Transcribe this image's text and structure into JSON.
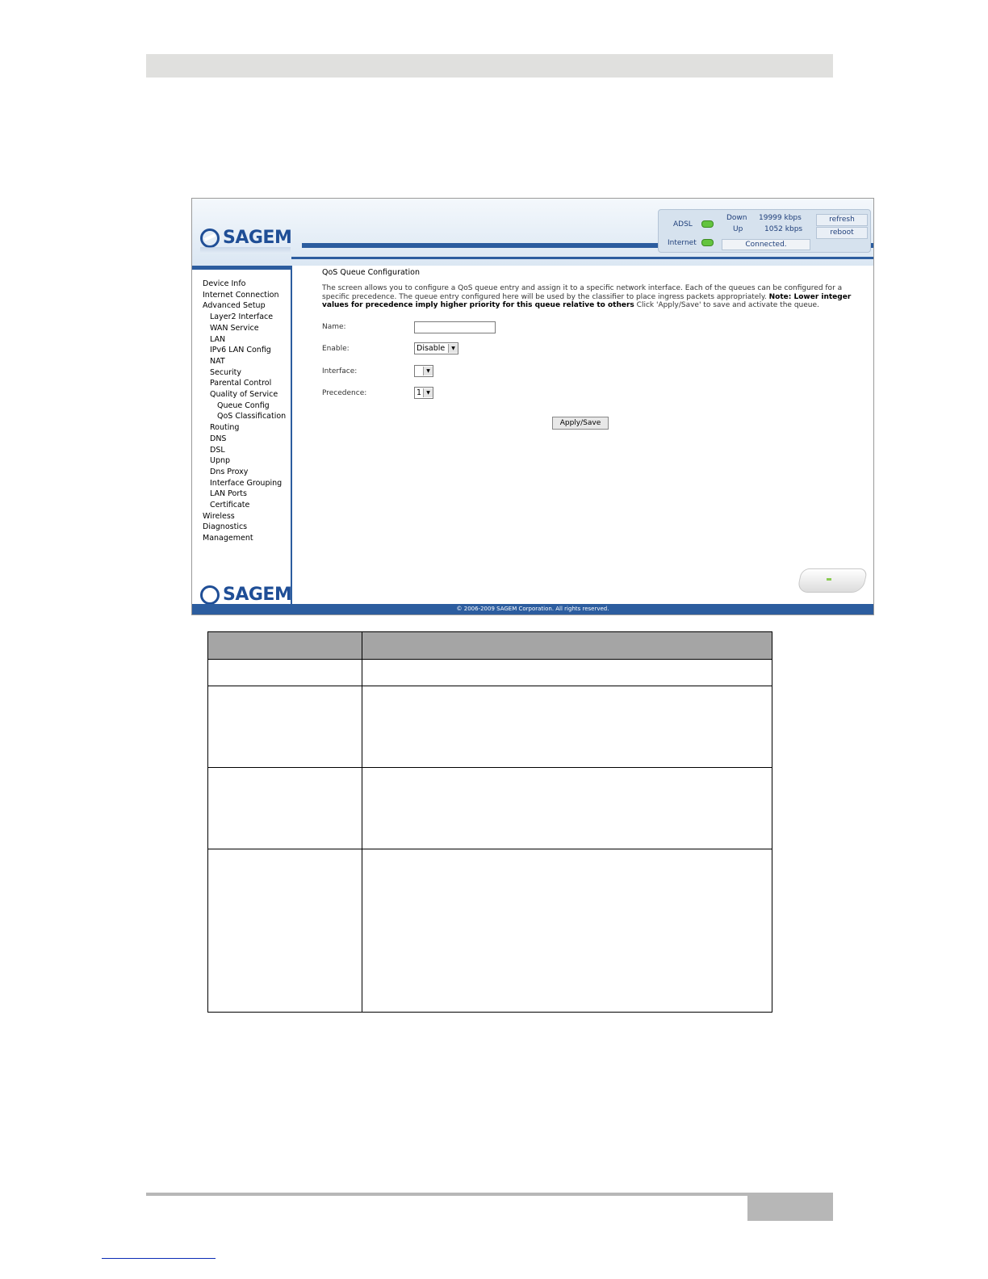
{
  "router_ui": {
    "brand": "SAGEM",
    "status": {
      "adsl_label": "ADSL",
      "internet_label": "Internet",
      "down_label": "Down",
      "down_value": "19999 kbps",
      "up_label": "Up",
      "up_value": "1052 kbps",
      "connection_status": "Connected.",
      "refresh_label": "refresh",
      "reboot_label": "reboot"
    },
    "sidebar": {
      "items": [
        {
          "label": "Device Info",
          "level": 1
        },
        {
          "label": "Internet Connection",
          "level": 1
        },
        {
          "label": "Advanced Setup",
          "level": 1
        },
        {
          "label": "Layer2 Interface",
          "level": 2
        },
        {
          "label": "WAN Service",
          "level": 2
        },
        {
          "label": "LAN",
          "level": 2
        },
        {
          "label": "IPv6 LAN Config",
          "level": 2
        },
        {
          "label": "NAT",
          "level": 2
        },
        {
          "label": "Security",
          "level": 2
        },
        {
          "label": "Parental Control",
          "level": 2
        },
        {
          "label": "Quality of Service",
          "level": 2
        },
        {
          "label": "Queue Config",
          "level": 3
        },
        {
          "label": "QoS Classification",
          "level": 3
        },
        {
          "label": "Routing",
          "level": 2
        },
        {
          "label": "DNS",
          "level": 2
        },
        {
          "label": "DSL",
          "level": 2
        },
        {
          "label": "Upnp",
          "level": 2
        },
        {
          "label": "Dns Proxy",
          "level": 2
        },
        {
          "label": "Interface Grouping",
          "level": 2
        },
        {
          "label": "LAN Ports",
          "level": 2
        },
        {
          "label": "Certificate",
          "level": 2
        },
        {
          "label": "Wireless",
          "level": 1
        },
        {
          "label": "Diagnostics",
          "level": 1
        },
        {
          "label": "Management",
          "level": 1
        }
      ]
    },
    "main": {
      "title": "QoS Queue Configuration",
      "desc_part1": "The screen allows you to configure a QoS queue entry and assign it to a specific network interface. Each of the queues can be configured for a specific precedence. The queue entry configured here will be used by the classifier to place ingress packets appropriately. ",
      "desc_bold": "Note: Lower integer values for precedence imply higher priority for this queue relative to others",
      "desc_part2": " Click 'Apply/Save' to save and activate the queue.",
      "form": {
        "name_label": "Name:",
        "name_value": "",
        "enable_label": "Enable:",
        "enable_value": "Disable",
        "interface_label": "Interface:",
        "interface_value": "",
        "precedence_label": "Precedence:",
        "precedence_value": "1"
      },
      "apply_label": "Apply/Save"
    },
    "footer": "© 2006-2009 SAGEM Corporation. All rights reserved."
  }
}
